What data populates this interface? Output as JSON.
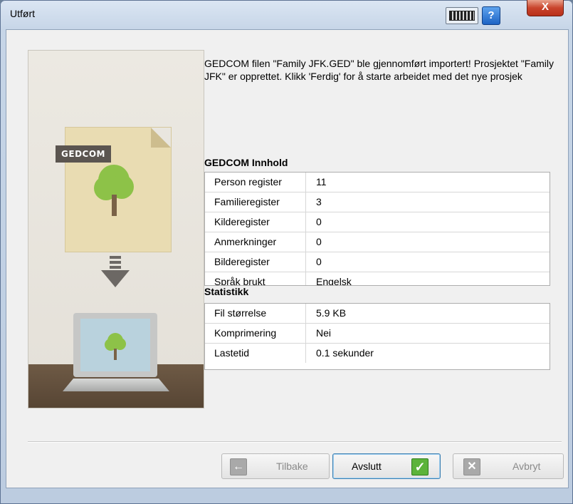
{
  "window": {
    "title": "Utført"
  },
  "titlebar": {
    "help_glyph": "?",
    "close_glyph": "X"
  },
  "illustration": {
    "badge": "GEDCOM"
  },
  "message": "GEDCOM filen \"Family JFK.GED\" ble gjennomført importert! Prosjektet \"Family JFK\" er opprettet. Klikk 'Ferdig' for å starte arbeidet med det nye prosjek",
  "gedcom_content": {
    "title": "GEDCOM Innhold",
    "rows": [
      {
        "name": "Person register",
        "value": "11"
      },
      {
        "name": "Familieregister",
        "value": "3"
      },
      {
        "name": "Kilderegister",
        "value": "0"
      },
      {
        "name": "Anmerkninger",
        "value": "0"
      },
      {
        "name": "Bilderegister",
        "value": "0"
      },
      {
        "name": "Språk brukt",
        "value": "Engelsk"
      }
    ]
  },
  "statistics": {
    "title": "Statistikk",
    "rows": [
      {
        "name": "Fil størrelse",
        "value": "5.9 KB"
      },
      {
        "name": "Komprimering",
        "value": "Nei"
      },
      {
        "name": "Lastetid",
        "value": "0.1 sekunder"
      }
    ]
  },
  "buttons": {
    "back": "Tilbake",
    "finish": "Avslutt",
    "cancel": "Avbryt"
  },
  "colors": {
    "accent_green": "#5cb33b",
    "disabled_icon": "#9a9a9a",
    "tree_green": "#8dc248"
  },
  "icons": [
    "keyboard-icon",
    "help-icon",
    "close-icon",
    "arrow-left-icon",
    "checkmark-icon",
    "x-icon",
    "tree-icon",
    "down-arrow-icon",
    "laptop-icon",
    "document-icon"
  ]
}
